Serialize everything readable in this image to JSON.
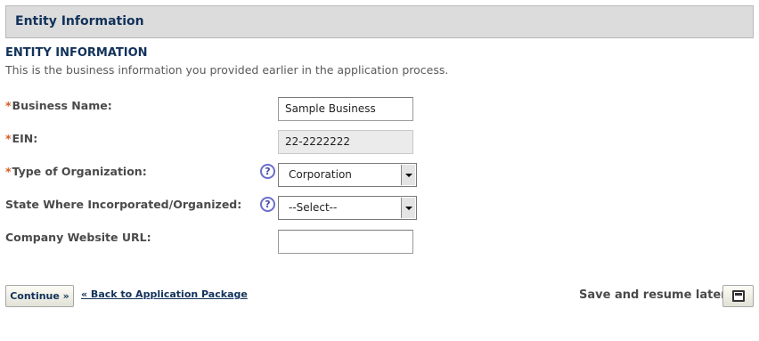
{
  "panel": {
    "title": "Entity Information"
  },
  "section": {
    "title": "ENTITY INFORMATION",
    "description": "This is the business information you provided earlier in the application process."
  },
  "required_marker": "*",
  "help_glyph": "?",
  "fields": {
    "business_name": {
      "label": "Business Name:",
      "value": "Sample Business",
      "required": true
    },
    "ein": {
      "label": "EIN:",
      "value": "22-2222222",
      "required": true,
      "disabled": true
    },
    "org_type": {
      "label": "Type of Organization:",
      "value": "Corporation",
      "required": true
    },
    "state": {
      "label": "State Where Incorporated/Organized:",
      "value": "--Select--",
      "required": false
    },
    "website": {
      "label": "Company Website URL:",
      "value": "",
      "required": false
    }
  },
  "actions": {
    "continue_label": "Continue »",
    "back_label": "« Back to Application Package",
    "save_resume_label": "Save and resume later:"
  },
  "colors": {
    "header_bg": "#dcdcdc",
    "title_text": "#12325a",
    "required": "#d55b1f",
    "help_icon": "#6b6fc9"
  }
}
